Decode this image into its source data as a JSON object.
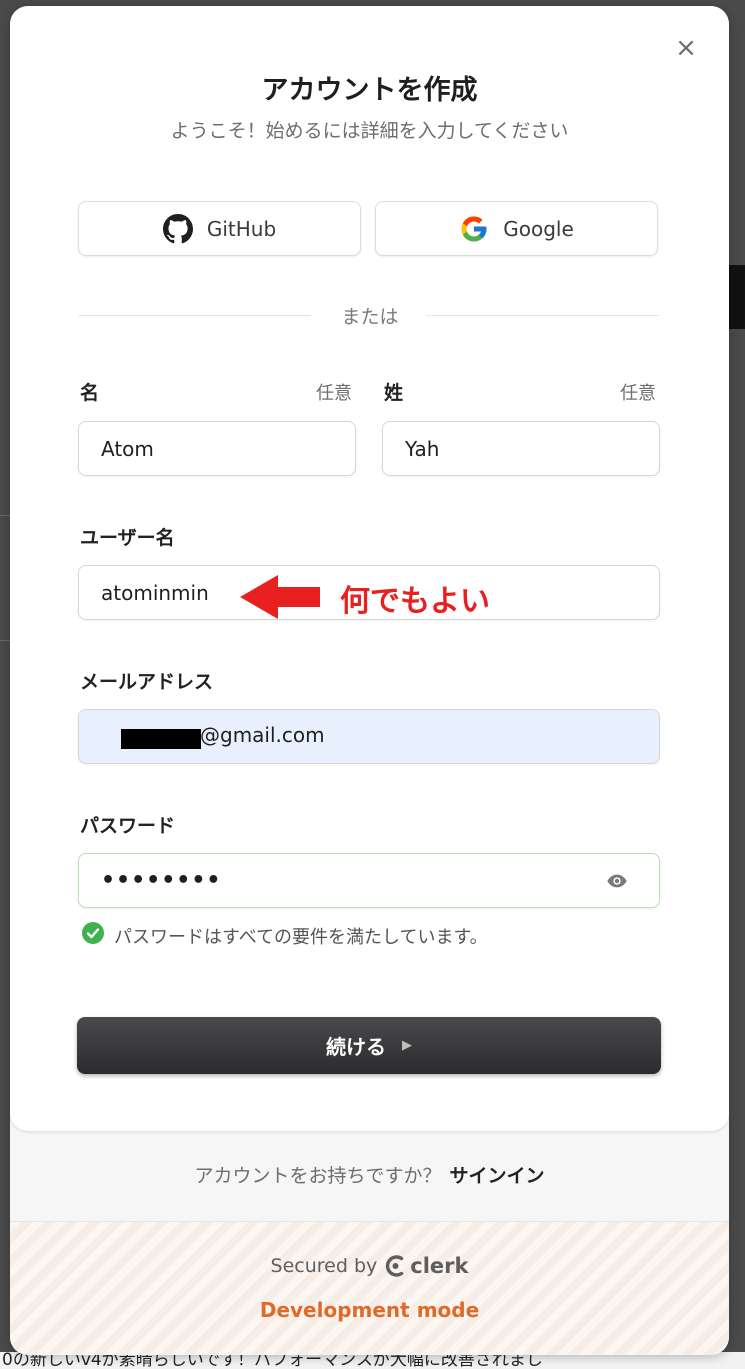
{
  "modal": {
    "title": "アカウントを作成",
    "subtitle": "ようこそ！始めるには詳細を入力してください",
    "close_symbol": "×"
  },
  "social": {
    "github_label": "GitHub",
    "google_label": "Google"
  },
  "divider_label": "または",
  "form": {
    "first_name": {
      "label": "名",
      "optional": "任意",
      "value": "Atom"
    },
    "last_name": {
      "label": "姓",
      "optional": "任意",
      "value": "Yah"
    },
    "username": {
      "label": "ユーザー名",
      "value": "atominmin"
    },
    "email": {
      "label": "メールアドレス",
      "value_visible": "@gmail.com"
    },
    "password": {
      "label": "パスワード",
      "value": "••••••••",
      "valid_message": "パスワードはすべての要件を満たしています。"
    }
  },
  "annotation": {
    "text": "何でもよい",
    "color": "#e8201f"
  },
  "continue_button": {
    "label": "続ける",
    "icon": "▶"
  },
  "footer": {
    "have_account": "アカウントをお持ちですか？",
    "signin_link": "サインイン",
    "secured_by": "Secured by",
    "brand": "clerk",
    "dev_mode": "Development mode"
  },
  "background_text": "0の新しいv4が素晴らしいです！パフォーマンスが大幅に改善されまし",
  "icons": [
    "close-icon",
    "github-icon",
    "google-icon",
    "eye-icon",
    "check-circle-icon",
    "play-icon",
    "clerk-logo-icon",
    "red-arrow-icon"
  ],
  "colors": {
    "accent_dark": "#2b2b2e",
    "dev_mode": "#e06a2a",
    "valid": "#3fb24f",
    "autofill": "#e9f0fd"
  }
}
